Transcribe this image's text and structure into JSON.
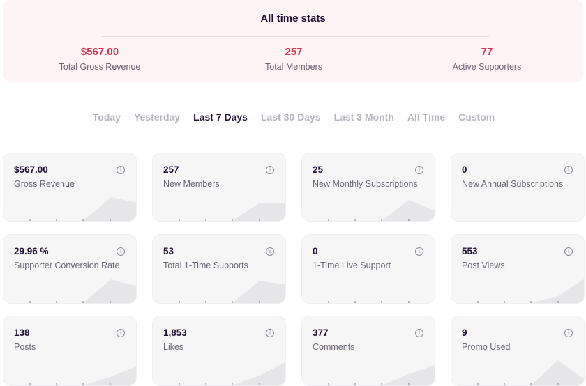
{
  "all_time": {
    "title": "All time stats",
    "stats": [
      {
        "value": "$567.00",
        "label": "Total Gross Revenue"
      },
      {
        "value": "257",
        "label": "Total Members"
      },
      {
        "value": "77",
        "label": "Active Supporters"
      }
    ]
  },
  "filters": {
    "items": [
      "Today",
      "Yesterday",
      "Last 7 Days",
      "Last 30 Days",
      "Last 3 Month",
      "All Time",
      "Custom"
    ],
    "active": "Last 7 Days"
  },
  "cards": [
    {
      "value": "$567.00",
      "label": "Gross Revenue"
    },
    {
      "value": "257",
      "label": "New Members"
    },
    {
      "value": "25",
      "label": "New Monthly Subscriptions"
    },
    {
      "value": "0",
      "label": "New Annual Subscriptions"
    },
    {
      "value": "29.96 %",
      "label": "Supporter Conversion Rate"
    },
    {
      "value": "53",
      "label": "Total 1-Time Supports"
    },
    {
      "value": "0",
      "label": "1-Time Live Support"
    },
    {
      "value": "553",
      "label": "Post Views"
    },
    {
      "value": "138",
      "label": "Posts"
    },
    {
      "value": "1,853",
      "label": "Likes"
    },
    {
      "value": "377",
      "label": "Comments"
    },
    {
      "value": "9",
      "label": "Promo Used"
    }
  ],
  "icons": {
    "info": "info-icon"
  },
  "colors": {
    "accent": "#d6324a",
    "active_filter": "#1f0f33",
    "inactive_filter": "#b8b3bf"
  }
}
